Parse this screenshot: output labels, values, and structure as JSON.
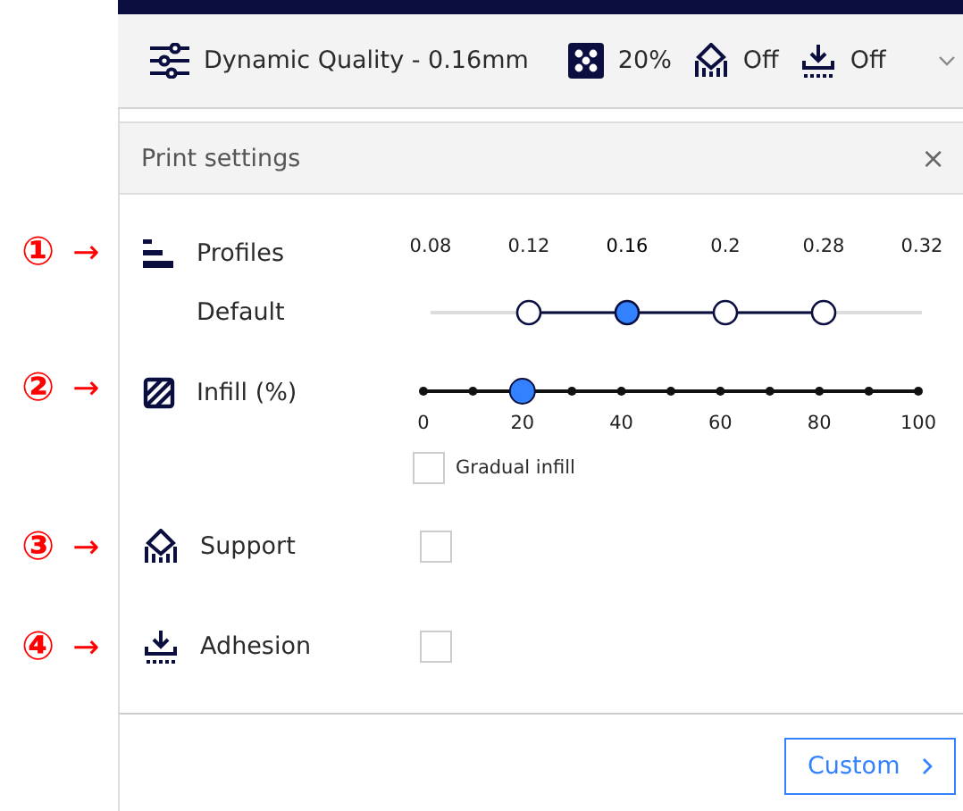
{
  "header": {
    "profile": "Dynamic Quality - 0.16mm",
    "infill": "20%",
    "support": "Off",
    "adhesion": "Off"
  },
  "panel": {
    "title": "Print settings",
    "close": "×"
  },
  "settings": [
    {
      "kind": "profiles",
      "marker": "①",
      "arrow": "→",
      "label": "Profiles",
      "sublabel": "Default",
      "options": [
        {
          "label": "0.08",
          "available": false,
          "selected": false
        },
        {
          "label": "0.12",
          "available": true,
          "selected": false
        },
        {
          "label": "0.16",
          "available": true,
          "selected": true
        },
        {
          "label": "0.2",
          "available": true,
          "selected": false
        },
        {
          "label": "0.28",
          "available": true,
          "selected": false
        },
        {
          "label": "0.32",
          "available": false,
          "selected": false
        }
      ]
    },
    {
      "kind": "slider",
      "marker": "②",
      "arrow": "→",
      "label": "Infill (%)",
      "level": 0.2,
      "ticks": [
        "0",
        "20",
        "40",
        "60",
        "80",
        "100"
      ],
      "gradual": {
        "label": "Gradual infill",
        "checked": false
      }
    },
    {
      "kind": "checkbox",
      "marker": "③",
      "arrow": "→",
      "label": "Support",
      "checked": false
    },
    {
      "kind": "checkbox",
      "marker": "④",
      "arrow": "→",
      "label": "Adhesion",
      "checked": false
    }
  ],
  "button": "Custom"
}
